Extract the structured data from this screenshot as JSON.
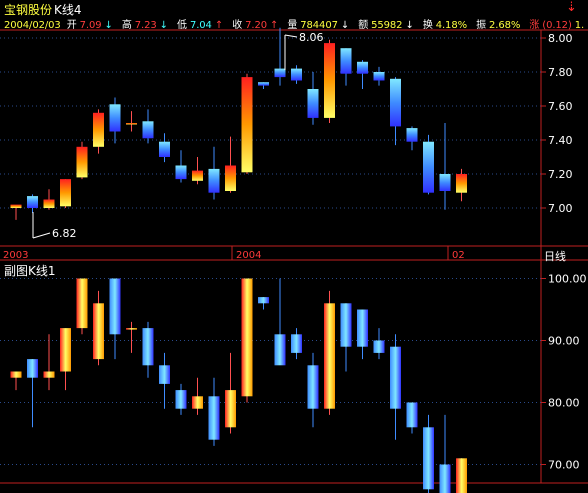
{
  "window": {
    "stock_name": "宝钢股份",
    "indicator": "K线4",
    "corner_icon": "red-down-arrow-icon"
  },
  "info_bar": {
    "date": "2004/02/03",
    "open_label": "开",
    "open": "7.09",
    "open_arrow": "↓",
    "high_label": "高",
    "high": "7.23",
    "high_arrow": "↓",
    "low_label": "低",
    "low": "7.04",
    "low_arrow": "↑",
    "close_label": "收",
    "close": "7.20",
    "close_arrow": "↑",
    "volume_label": "量",
    "volume": "784407",
    "volume_arrow": "↓",
    "amount_label": "额",
    "amount": "55982",
    "amount_arrow": "↓",
    "turnover_label": "换",
    "turnover": "4.18%",
    "amplitude_label": "振",
    "amplitude": "2.68%",
    "change_label": "涨",
    "change": "(0.12)",
    "change_tail": "1.",
    "colors": {
      "date": "#ffff40",
      "label": "#ffffff",
      "up": "#ff3c3c",
      "down": "#40ffff",
      "neutral": "#ffff40"
    }
  },
  "main_chart": {
    "high_annotation": "8.06",
    "low_annotation": "6.82",
    "period_label": "日线"
  },
  "sub_chart": {
    "title": "副图K线1"
  },
  "date_axis": [
    "2003",
    "2004",
    "02"
  ],
  "colors": {
    "bull_light": "#ffff66",
    "bull_mid": "#ff9900",
    "bull_dark": "#ff2020",
    "bear_light": "#80e8ff",
    "bear_mid": "#3f8cff",
    "bear_dark": "#3030ff",
    "wick": "#ff5050",
    "axis": "#c02020",
    "grid": "#2a4a8a",
    "label": "#ffffff"
  },
  "chart_data": [
    {
      "type": "candlestick",
      "title": "K线4",
      "y_ticks": [
        7.0,
        7.2,
        7.4,
        7.6,
        7.8,
        8.0
      ],
      "ylim": [
        6.85,
        8.1
      ],
      "x_labels": [
        "2003",
        "2004",
        "02"
      ],
      "candles": [
        {
          "o": 7.0,
          "h": 7.01,
          "l": 6.93,
          "c": 7.02
        },
        {
          "o": 7.07,
          "h": 7.08,
          "l": 6.97,
          "c": 7.0
        },
        {
          "o": 7.0,
          "h": 7.11,
          "l": 6.99,
          "c": 7.05
        },
        {
          "o": 7.01,
          "h": 7.17,
          "l": 7.0,
          "c": 7.17
        },
        {
          "o": 7.18,
          "h": 7.39,
          "l": 7.17,
          "c": 7.36
        },
        {
          "o": 7.36,
          "h": 7.58,
          "l": 7.32,
          "c": 7.56
        },
        {
          "o": 7.61,
          "h": 7.65,
          "l": 7.38,
          "c": 7.45
        },
        {
          "o": 7.5,
          "h": 7.57,
          "l": 7.45,
          "c": 7.5
        },
        {
          "o": 7.51,
          "h": 7.58,
          "l": 7.38,
          "c": 7.41
        },
        {
          "o": 7.39,
          "h": 7.44,
          "l": 7.27,
          "c": 7.3
        },
        {
          "o": 7.25,
          "h": 7.34,
          "l": 7.15,
          "c": 7.17
        },
        {
          "o": 7.16,
          "h": 7.3,
          "l": 7.14,
          "c": 7.22
        },
        {
          "o": 7.23,
          "h": 7.36,
          "l": 7.05,
          "c": 7.09
        },
        {
          "o": 7.1,
          "h": 7.42,
          "l": 7.09,
          "c": 7.25
        },
        {
          "o": 7.21,
          "h": 7.79,
          "l": 7.2,
          "c": 7.77
        },
        {
          "o": 7.74,
          "h": 7.74,
          "l": 7.7,
          "c": 7.72
        },
        {
          "o": 7.82,
          "h": 8.06,
          "l": 7.72,
          "c": 7.77
        },
        {
          "o": 7.82,
          "h": 7.84,
          "l": 7.73,
          "c": 7.75
        },
        {
          "o": 7.7,
          "h": 7.8,
          "l": 7.49,
          "c": 7.53
        },
        {
          "o": 7.53,
          "h": 7.99,
          "l": 7.5,
          "c": 7.97
        },
        {
          "o": 7.94,
          "h": 7.94,
          "l": 7.72,
          "c": 7.79
        },
        {
          "o": 7.86,
          "h": 7.87,
          "l": 7.7,
          "c": 7.79
        },
        {
          "o": 7.8,
          "h": 7.83,
          "l": 7.72,
          "c": 7.75
        },
        {
          "o": 7.76,
          "h": 7.77,
          "l": 7.37,
          "c": 7.48
        },
        {
          "o": 7.47,
          "h": 7.48,
          "l": 7.34,
          "c": 7.39
        },
        {
          "o": 7.39,
          "h": 7.43,
          "l": 7.08,
          "c": 7.09
        },
        {
          "o": 7.2,
          "h": 7.5,
          "l": 6.99,
          "c": 7.1
        },
        {
          "o": 7.09,
          "h": 7.23,
          "l": 7.04,
          "c": 7.2
        }
      ]
    },
    {
      "type": "candlestick",
      "title": "副图K线1",
      "y_ticks": [
        70.0,
        80.0,
        90.0,
        100.0
      ],
      "ylim": [
        62,
        102
      ],
      "candles": [
        {
          "o": 84,
          "h": 85,
          "l": 82,
          "c": 85
        },
        {
          "o": 87,
          "h": 87,
          "l": 76,
          "c": 84
        },
        {
          "o": 84,
          "h": 91,
          "l": 82,
          "c": 85
        },
        {
          "o": 85,
          "h": 91,
          "l": 82,
          "c": 92
        },
        {
          "o": 92,
          "h": 100,
          "l": 91,
          "c": 100
        },
        {
          "o": 87,
          "h": 98,
          "l": 86,
          "c": 96
        },
        {
          "o": 100,
          "h": 100,
          "l": 87,
          "c": 91
        },
        {
          "o": 92,
          "h": 93,
          "l": 88,
          "c": 92
        },
        {
          "o": 92,
          "h": 93,
          "l": 84,
          "c": 86
        },
        {
          "o": 86,
          "h": 88,
          "l": 79,
          "c": 83
        },
        {
          "o": 82,
          "h": 83,
          "l": 78,
          "c": 79
        },
        {
          "o": 79,
          "h": 84,
          "l": 78,
          "c": 81
        },
        {
          "o": 81,
          "h": 84,
          "l": 73,
          "c": 74
        },
        {
          "o": 76,
          "h": 88,
          "l": 75,
          "c": 82
        },
        {
          "o": 81,
          "h": 100,
          "l": 80,
          "c": 100
        },
        {
          "o": 97,
          "h": 97,
          "l": 95,
          "c": 96
        },
        {
          "o": 91,
          "h": 100,
          "l": 87,
          "c": 86
        },
        {
          "o": 91,
          "h": 92,
          "l": 87,
          "c": 88
        },
        {
          "o": 86,
          "h": 88,
          "l": 76,
          "c": 79
        },
        {
          "o": 79,
          "h": 98,
          "l": 78,
          "c": 96
        },
        {
          "o": 96,
          "h": 96,
          "l": 85,
          "c": 89
        },
        {
          "o": 95,
          "h": 95,
          "l": 87,
          "c": 89
        },
        {
          "o": 90,
          "h": 92,
          "l": 87,
          "c": 88
        },
        {
          "o": 89,
          "h": 91,
          "l": 74,
          "c": 79
        },
        {
          "o": 80,
          "h": 80,
          "l": 75,
          "c": 76
        },
        {
          "o": 76,
          "h": 78,
          "l": 65,
          "c": 66
        },
        {
          "o": 70,
          "h": 78,
          "l": 63,
          "c": 65
        },
        {
          "o": 65,
          "h": 71,
          "l": 64,
          "c": 71
        }
      ]
    }
  ]
}
